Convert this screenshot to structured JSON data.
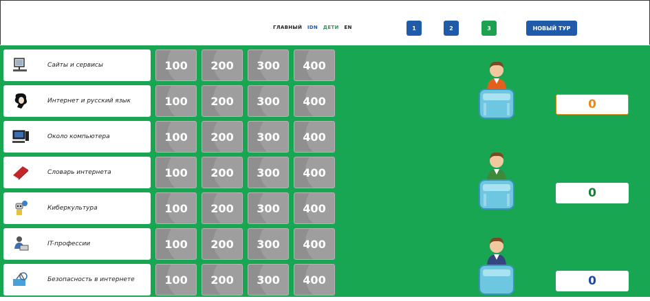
{
  "nav": {
    "main": "ГЛАВНЫЙ",
    "idn": "IDN",
    "kids": "ДЕТИ",
    "en": "EN"
  },
  "rounds": [
    {
      "label": "1",
      "color": "#1f5ba8"
    },
    {
      "label": "2",
      "color": "#1f5ba8"
    },
    {
      "label": "3",
      "color": "#1da24f"
    }
  ],
  "new_tour": "НОВЫЙ ТУР",
  "categories": [
    {
      "label": "Сайты и сервисы",
      "icon": "computer-monitor-icon"
    },
    {
      "label": "Интернет и русский язык",
      "icon": "pushkin-portrait-icon"
    },
    {
      "label": "Около компьютера",
      "icon": "desktop-pc-icon"
    },
    {
      "label": "Словарь интернета",
      "icon": "red-book-icon"
    },
    {
      "label": "Киберкультура",
      "icon": "robot-icon"
    },
    {
      "label": "IT-профессии",
      "icon": "user-at-laptop-icon"
    },
    {
      "label": "Безопасность в интернете",
      "icon": "secure-globe-icon"
    }
  ],
  "values": [
    "100",
    "200",
    "300",
    "400"
  ],
  "players": [
    {
      "score": "0",
      "shirt_color": "#e0601c",
      "score_color": "#e88a1a"
    },
    {
      "score": "0",
      "shirt_color": "#3d8a3d",
      "score_color": "#1a7d3a"
    },
    {
      "score": "0",
      "shirt_color": "#33477e",
      "score_color": "#1f4aa0"
    }
  ],
  "colors": {
    "board_green": "#19a653",
    "tile_gray": "#8f8f8f",
    "nav_blue": "#1f5ba8",
    "nav_green": "#1da24f"
  }
}
